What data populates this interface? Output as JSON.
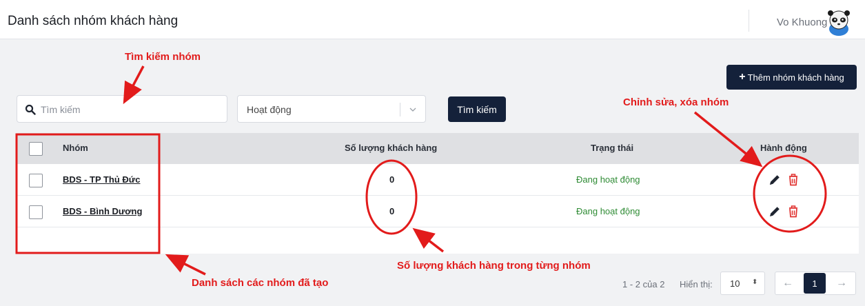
{
  "header": {
    "title": "Danh sách nhóm khách hàng",
    "user_name": "Vo Khuong"
  },
  "toolbar": {
    "add_label": "Thêm nhóm khách hàng",
    "search_placeholder": "Tìm kiếm",
    "status_value": "Hoạt động",
    "search_button": "Tìm kiếm"
  },
  "table": {
    "columns": [
      "Nhóm",
      "Số lượng khách hàng",
      "Trạng thái",
      "Hành động"
    ],
    "rows": [
      {
        "group": "BDS - TP Thủ Đức",
        "count": "0",
        "status": "Đang hoạt động"
      },
      {
        "group": "BDS - Bình Dương",
        "count": "0",
        "status": "Đang hoạt động"
      }
    ]
  },
  "pagination": {
    "range": "1 - 2 của 2",
    "show_label": "Hiển thị:",
    "per_page": "10",
    "current_page": "1"
  },
  "annotations": {
    "search_note": "Tìm kiếm nhóm",
    "edit_note": "Chỉnh sửa, xóa nhóm",
    "count_note": "Số lượng khách hàng trong từng nhóm",
    "list_note": "Danh sách các nhóm đã tạo"
  },
  "colors": {
    "primary": "#14213a",
    "active_status": "#2e8b34",
    "delete": "#e0312f",
    "annotation": "#e21b1b"
  }
}
